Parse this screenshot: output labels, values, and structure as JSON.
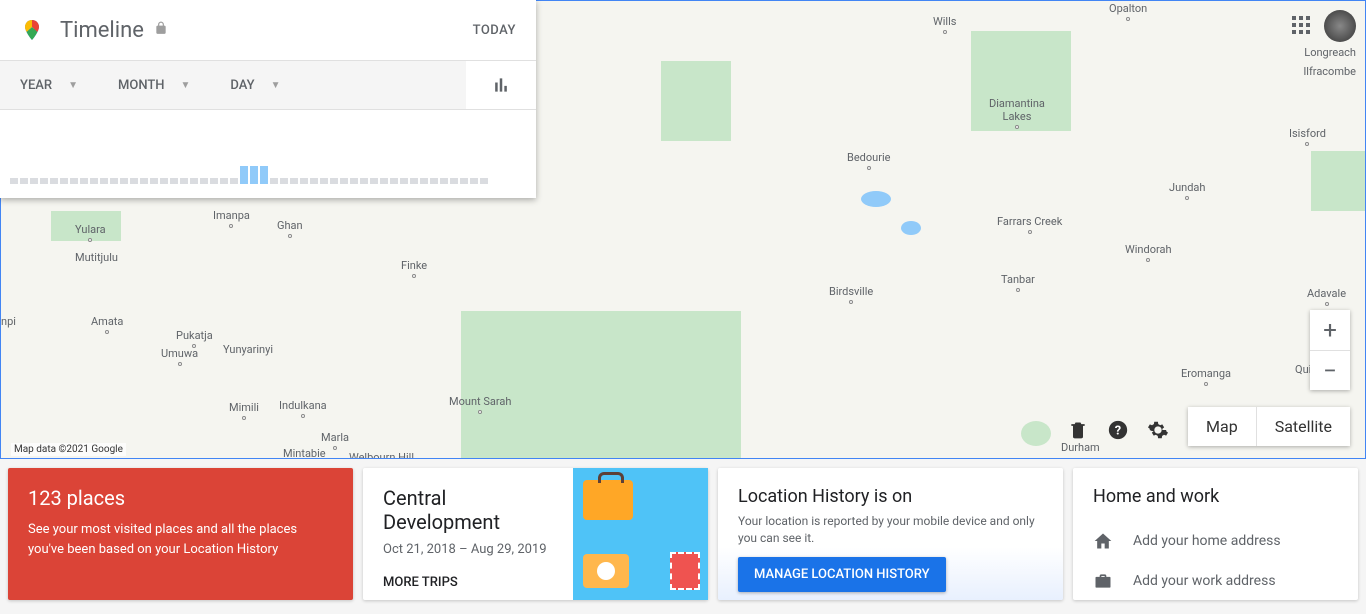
{
  "header": {
    "title": "Timeline",
    "today_label": "TODAY"
  },
  "selectors": {
    "year": "YEAR",
    "month": "MONTH",
    "day": "DAY"
  },
  "map": {
    "attribution": "Map data ©2021 Google",
    "type_map": "Map",
    "type_satellite": "Satellite",
    "labels": [
      "Yulara",
      "Mutitjulu",
      "Imanpa",
      "Ghan",
      "Finke",
      "Amata",
      "Pukatja",
      "Umuwa",
      "Yunyarinyi",
      "Mimili",
      "Indulkana",
      "Marla",
      "Mintabie",
      "Mount Sarah",
      "Welbourn Hill",
      "Bedourie",
      "Birdsville",
      "Wills",
      "Opalton",
      "Diamantina Lakes",
      "Farrars Creek",
      "Jundah",
      "Windorah",
      "Tanbar",
      "Longreach",
      "Ilfracombe",
      "Isisford",
      "Adavale",
      "Eromanga",
      "Quilpie",
      "Durham",
      "npi"
    ]
  },
  "top_right_line1": "Longreach",
  "top_right_line2": "Ilfracombe",
  "cards": {
    "places": {
      "title": "123 places",
      "desc": "See your most visited places and all the places you've been based on your Location History"
    },
    "trip": {
      "title": "Central Development",
      "date_range": "Oct 21, 2018 – Aug 29, 2019",
      "more": "MORE TRIPS"
    },
    "location": {
      "title": "Location History is on",
      "desc": "Your location is reported by your mobile device and only you can see it.",
      "button": "MANAGE LOCATION HISTORY"
    },
    "home_work": {
      "title": "Home and work",
      "home": "Add your home address",
      "work": "Add your work address"
    }
  }
}
